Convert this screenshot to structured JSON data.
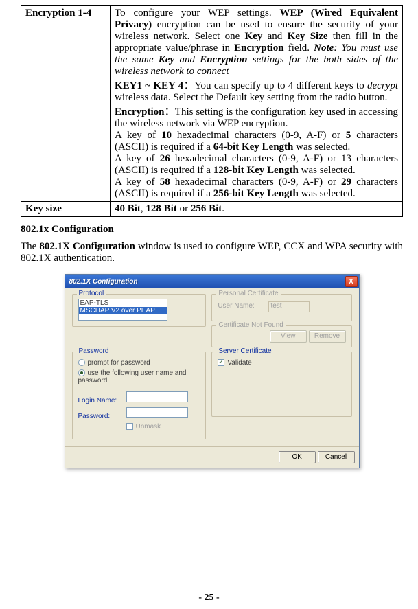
{
  "table": {
    "row1": {
      "label": "Encryption 1-4",
      "p1_a": "To configure your WEP settings. ",
      "p1_b": "WEP (Wired Equivalent Privacy)",
      "p1_c": " encryption can be used to ensure the security of your wireless network. Select one ",
      "p1_d": "Key",
      "p1_e": " and ",
      "p1_f": "Key Size",
      "p1_g": " then fill in the appropriate value/phrase in ",
      "p1_h": "Encryption",
      "p1_i": " field. ",
      "p1_j": "Note",
      "p1_k": ": You must use the same ",
      "p1_l": "Key",
      "p1_m": " and ",
      "p1_n": "Encryption",
      "p1_o": " settings for the both sides of the wireless network to connect",
      "p2_a": "KEY1 ~ KEY 4",
      "p2_b": "：You can specify up to 4 different keys to ",
      "p2_c": "decrypt",
      "p2_d": " wireless data. Select the Default key setting from the radio button.",
      "p3_a": "Encryption",
      "p3_b": "：This setting is the configuration key used in accessing the wireless network via WEP encryption.",
      "p4_a": "A key of ",
      "p4_b": "10",
      "p4_c": " hexadecimal characters (0-9, A-F) or ",
      "p4_d": "5",
      "p4_e": " characters (ASCII) is required if a ",
      "p4_f": "64-bit Key Length",
      "p4_g": " was selected.",
      "p5_a": "A key of ",
      "p5_b": "26",
      "p5_c": " hexadecimal characters (0-9, A-F) or 13 characters (ASCII) is required if a ",
      "p5_d": "128-bit Key Length",
      "p5_e": " was selected.",
      "p6_a": "A key of ",
      "p6_b": "58",
      "p6_c": " hexadecimal characters (0-9, A-F) or ",
      "p6_d": "29",
      "p6_e": " characters (ASCII)  is required if a ",
      "p6_f": "256-bit Key Length",
      "p6_g": " was selected."
    },
    "row2": {
      "label": "Key size",
      "v_a": "40 Bit",
      "v_b": ", ",
      "v_c": "128 Bit",
      "v_d": " or ",
      "v_e": "256 Bit",
      "v_f": "."
    }
  },
  "section_head": "802.1x Configuration",
  "para_a": "The ",
  "para_b": "802.1X Configuration",
  "para_c": " window is used to configure WEP, CCX and WPA security with 802.1X authentication.",
  "dialog": {
    "title": "802.1X Configuration",
    "close": "X",
    "protocol_lbl": "Protocol",
    "proto_opt1": "EAP-TLS",
    "proto_opt2": "MSCHAP V2 over PEAP",
    "pc_lbl": "Personal Certificate",
    "pc_user": "User Name:",
    "pc_user_val": "test",
    "cnf_lbl": "Certificate Not Found",
    "view": "View",
    "remove": "Remove",
    "pwd_lbl": "Password",
    "pwd_r1": "prompt for password",
    "pwd_r2": "use the following user name and password",
    "login": "Login Name:",
    "pass": "Password:",
    "unmask": "Unmask",
    "sc_lbl": "Server Certificate",
    "validate": "Validate",
    "ok": "OK",
    "cancel": "Cancel"
  },
  "page_num": "- 25 -"
}
